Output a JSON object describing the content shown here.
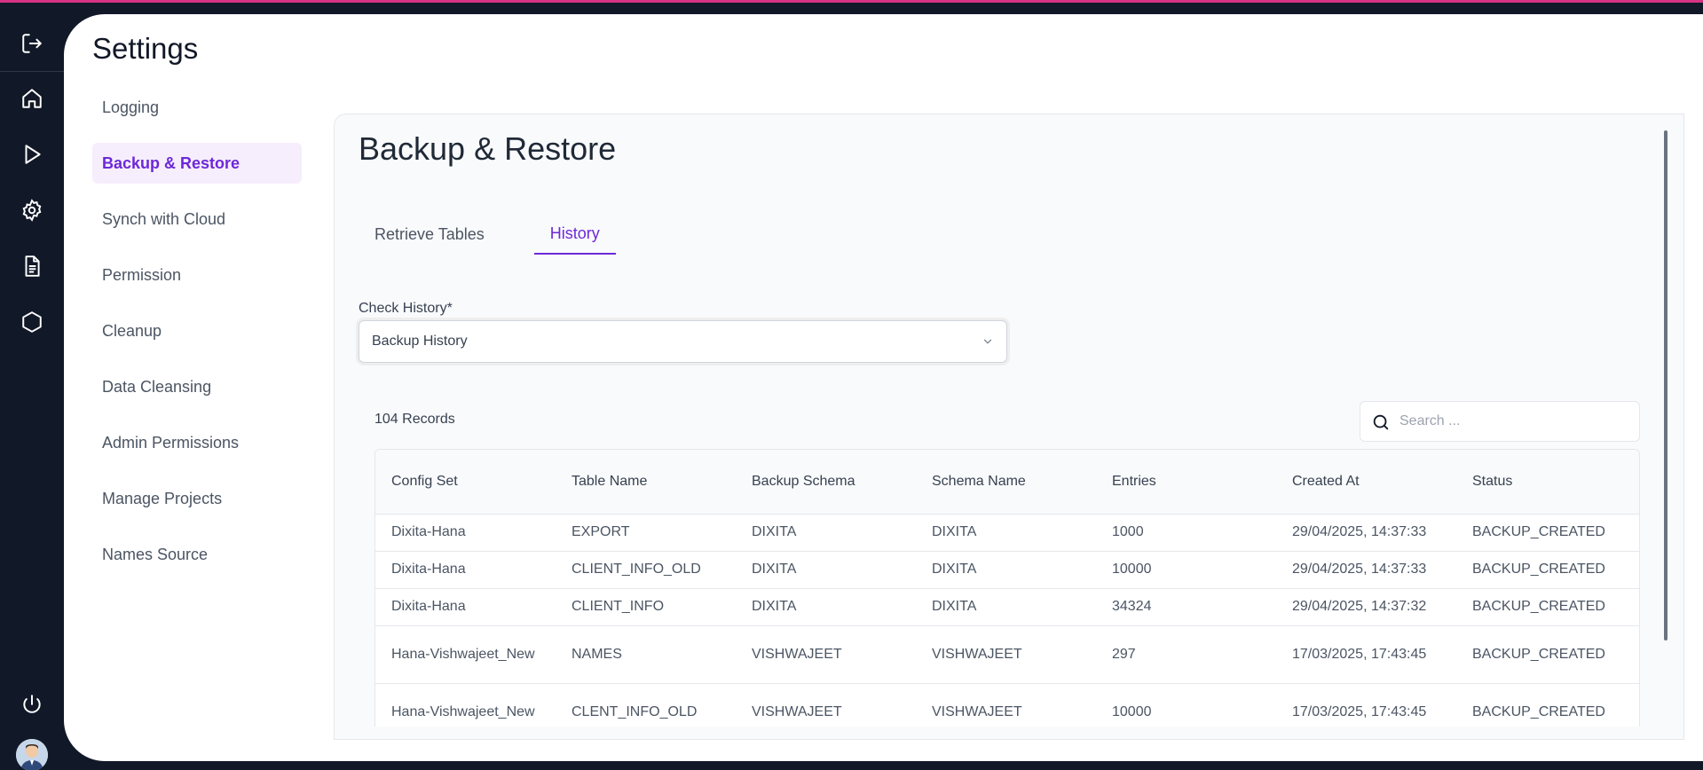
{
  "rail": {
    "icons": [
      "logout-icon",
      "home-icon",
      "play-icon",
      "settings-gear-icon",
      "document-icon",
      "hexagon-icon",
      "power-icon"
    ]
  },
  "page": {
    "title": "Settings"
  },
  "side_nav": {
    "items": [
      {
        "label": "Logging"
      },
      {
        "label": "Backup & Restore",
        "active": true
      },
      {
        "label": "Synch with Cloud"
      },
      {
        "label": "Permission"
      },
      {
        "label": "Cleanup"
      },
      {
        "label": "Data Cleansing"
      },
      {
        "label": "Admin Permissions"
      },
      {
        "label": "Manage Projects"
      },
      {
        "label": "Names Source"
      }
    ]
  },
  "panel": {
    "title": "Backup & Restore",
    "tabs": [
      {
        "label": "Retrieve Tables"
      },
      {
        "label": "History",
        "active": true
      }
    ],
    "check_history": {
      "label": "Check History*",
      "value": "Backup History"
    },
    "records_count": "104 Records",
    "search": {
      "placeholder": "Search ..."
    }
  },
  "table": {
    "columns": [
      "Config Set",
      "Table Name",
      "Backup Schema",
      "Schema Name",
      "Entries",
      "Created At",
      "Status"
    ],
    "rows": [
      [
        "Dixita-Hana",
        "EXPORT",
        "DIXITA",
        "DIXITA",
        "1000",
        "29/04/2025, 14:37:33",
        "BACKUP_CREATED"
      ],
      [
        "Dixita-Hana",
        "CLIENT_INFO_OLD",
        "DIXITA",
        "DIXITA",
        "10000",
        "29/04/2025, 14:37:33",
        "BACKUP_CREATED"
      ],
      [
        "Dixita-Hana",
        "CLIENT_INFO",
        "DIXITA",
        "DIXITA",
        "34324",
        "29/04/2025, 14:37:32",
        "BACKUP_CREATED"
      ],
      [
        "Hana-Vishwajeet_New",
        "NAMES",
        "VISHWAJEET",
        "VISHWAJEET",
        "297",
        "17/03/2025, 17:43:45",
        "BACKUP_CREATED"
      ],
      [
        "Hana-Vishwajeet_New",
        "CLENT_INFO_OLD",
        "VISHWAJEET",
        "VISHWAJEET",
        "10000",
        "17/03/2025, 17:43:45",
        "BACKUP_CREATED"
      ]
    ]
  },
  "colors": {
    "accent": "#6d28d9",
    "rail_bg": "#111827",
    "top_strip": "#d63384",
    "active_bg": "#f6eefc"
  }
}
